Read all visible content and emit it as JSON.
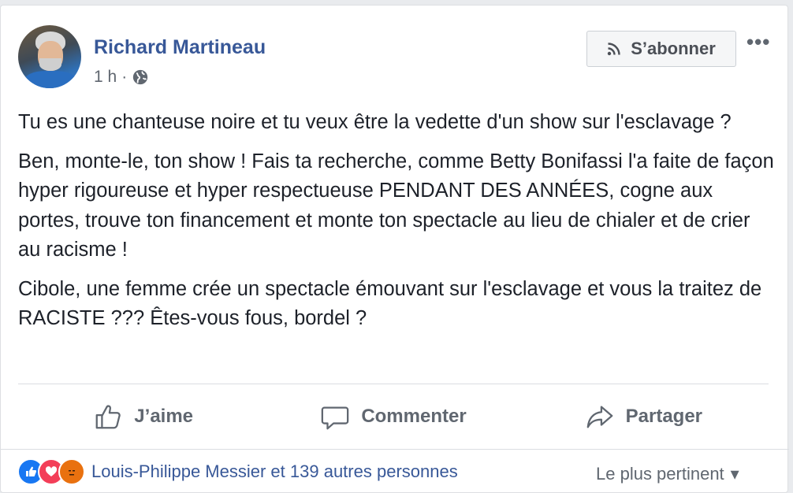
{
  "post": {
    "author": "Richard Martineau",
    "time": "1 h",
    "separator": "·",
    "privacy_icon": "globe-icon",
    "follow_label": "S’abonner",
    "more_label": "•••",
    "paragraphs": [
      "Tu es une chanteuse noire et tu veux être la vedette d'un show sur l'esclavage ?",
      "Ben, monte-le, ton show ! Fais ta recherche, comme Betty Bonifassi l'a faite de façon hyper rigoureuse et hyper respectueuse PENDANT DES ANNÉES, cogne aux portes, trouve ton financement et monte ton spectacle au lieu de chialer et de crier au racisme !",
      "Cibole, une femme crée un spectacle émouvant sur l'esclavage et vous la traitez de RACISTE ??? Êtes-vous fous, bordel ?"
    ]
  },
  "actions": {
    "like": "J’aime",
    "comment": "Commenter",
    "share": "Partager"
  },
  "reactions": {
    "summary": "Louis-Philippe Messier et 139 autres personnes",
    "icons": [
      "like-icon",
      "love-icon",
      "angry-icon"
    ]
  },
  "sort": {
    "label": "Le plus pertinent",
    "caret": "▾"
  },
  "colors": {
    "link": "#385898",
    "muted": "#606770",
    "text": "#1d2129"
  }
}
